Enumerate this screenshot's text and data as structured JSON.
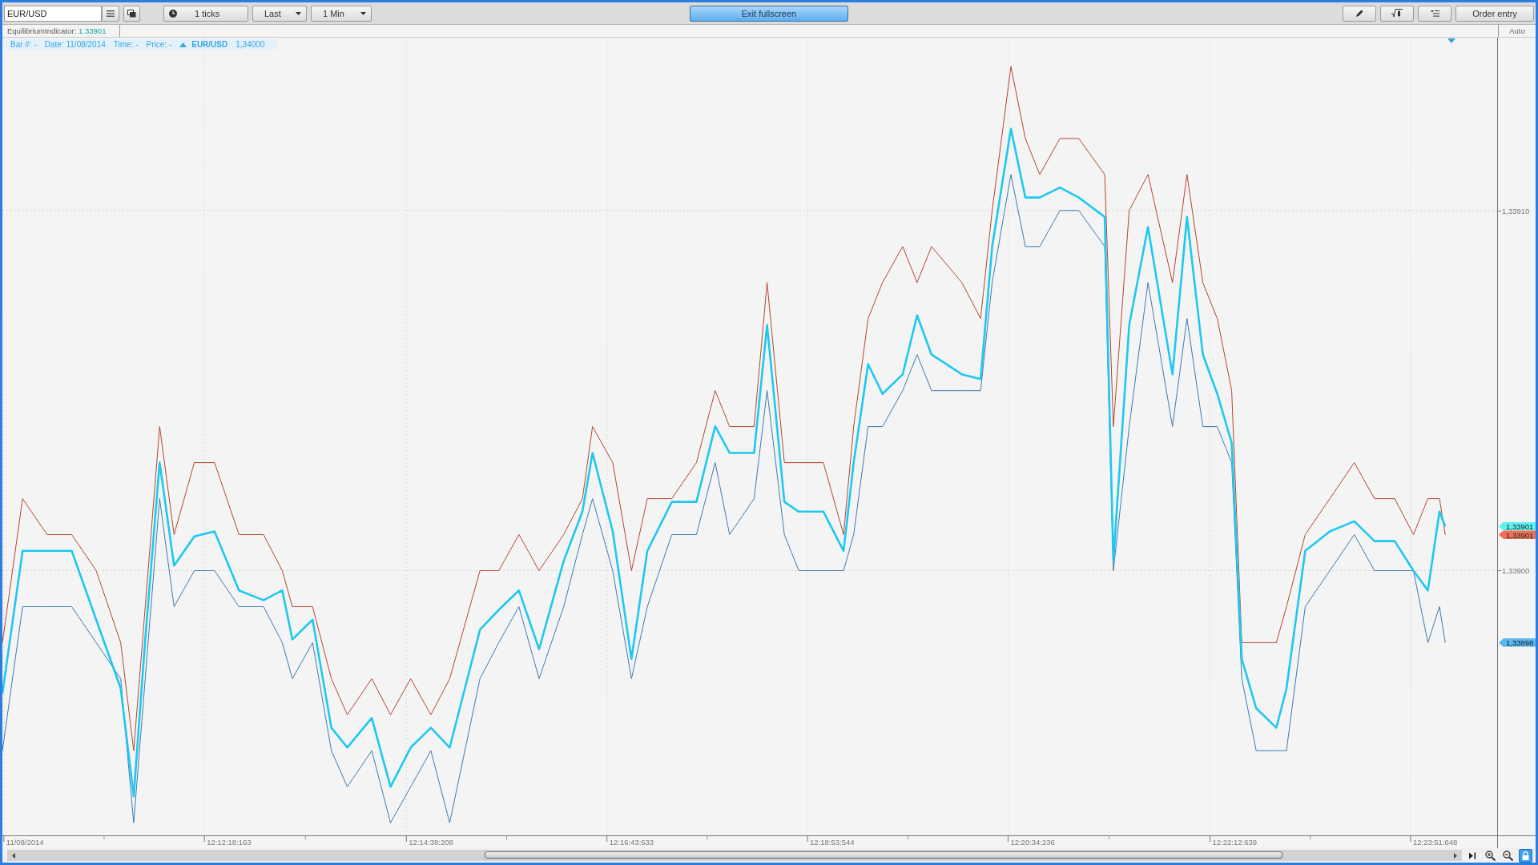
{
  "toolbar": {
    "symbol_field": {
      "value": "EUR/USD"
    },
    "tick_button": {
      "label": "1 ticks"
    },
    "dropdowns": [
      {
        "label": "Last"
      },
      {
        "label": "1 Min"
      }
    ],
    "fullscreen_button": {
      "label": "Exit fullscreen"
    },
    "order_button": {
      "label": "Order entry"
    }
  },
  "legend": {
    "indicator_name": "EquilibriumIndicator:",
    "indicator_value": "1.33901",
    "scale_mode": "Auto"
  },
  "info_bar": {
    "fields": [
      "Bar #: -",
      "Date: 11/08/2014",
      "Time: -",
      "Price: -"
    ],
    "symbol": "EUR/USD",
    "price": "1,34000"
  },
  "chart": {
    "price_axis_labels": [
      "1,33910",
      "1,33900"
    ],
    "time_axis_labels": [
      "11/08/2014",
      "12:12:18:163",
      "12:14:38:208",
      "12:16:43:633",
      "12:18:53:544",
      "12:20:34:236",
      "12:22:12:639",
      "12:23:51:648"
    ],
    "price_markers": [
      {
        "label": "1,33901",
        "color": "#5ff0f0"
      },
      {
        "label": "1,33901",
        "color": "#f0705a"
      },
      {
        "label": "1,33898",
        "color": "#5ab8f0"
      }
    ]
  },
  "footer": {
    "lock": {
      "on": true
    }
  }
}
